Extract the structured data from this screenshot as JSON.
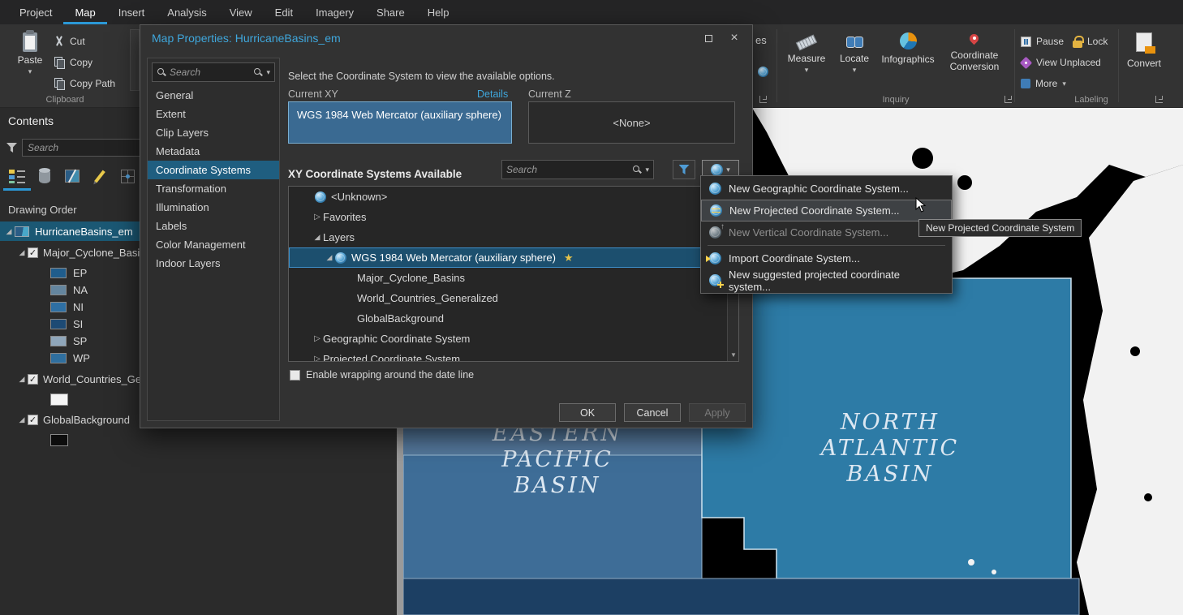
{
  "menubar": {
    "items": [
      "Project",
      "Map",
      "Insert",
      "Analysis",
      "View",
      "Edit",
      "Imagery",
      "Share",
      "Help"
    ]
  },
  "ribbon": {
    "clipboard": {
      "paste": "Paste",
      "cut": "Cut",
      "copy": "Copy",
      "copy_path": "Copy Path",
      "group": "Clipboard"
    },
    "clipped_text": "es",
    "inquiry": {
      "measure": "Measure",
      "locate": "Locate",
      "infographics": "Infographics",
      "coord_line1": "Coordinate",
      "coord_line2": "Conversion",
      "group": "Inquiry"
    },
    "labeling": {
      "pause": "Pause",
      "lock": "Lock",
      "view_unplaced": "View Unplaced",
      "more": "More",
      "convert": "Convert",
      "group": "Labeling"
    }
  },
  "contents": {
    "title": "Contents",
    "search_placeholder": "Search",
    "drawing_order": "Drawing Order",
    "map_item": "HurricaneBasins_em",
    "group_layer": "Major_Cyclone_Basins",
    "legend": [
      {
        "label": "EP",
        "color": "#205d8c"
      },
      {
        "label": "NA",
        "color": "#64859e"
      },
      {
        "label": "NI",
        "color": "#2e6fa3"
      },
      {
        "label": "SI",
        "color": "#1d4a74"
      },
      {
        "label": "SP",
        "color": "#8fa6ba"
      },
      {
        "label": "WP",
        "color": "#2f6f9f"
      }
    ],
    "countries_layer": "World_Countries_Generalized",
    "countries_swatch": "#f5f5f5",
    "background_layer": "GlobalBackground",
    "background_swatch": "#0d0d0d"
  },
  "dialog": {
    "title": "Map Properties: HurricaneBasins_em",
    "sidebar_search_placeholder": "Search",
    "nav": [
      "General",
      "Extent",
      "Clip Layers",
      "Metadata",
      "Coordinate Systems",
      "Transformation",
      "Illumination",
      "Labels",
      "Color Management",
      "Indoor Layers"
    ],
    "instruction": "Select the Coordinate System to view the available options.",
    "current_xy_label": "Current XY",
    "details_link": "Details",
    "current_z_label": "Current Z",
    "current_xy_value": "WGS 1984 Web Mercator (auxiliary sphere)",
    "current_z_value": "<None>",
    "available_heading": "XY Coordinate Systems Available",
    "tree_search_placeholder": "Search",
    "tree": [
      "<Unknown>",
      "Favorites",
      "Layers",
      "WGS 1984 Web Mercator (auxiliary sphere)",
      "Major_Cyclone_Basins",
      "World_Countries_Generalized",
      "GlobalBackground",
      "Geographic Coordinate System",
      "Projected Coordinate System"
    ],
    "wrap_label": "Enable wrapping around the date line",
    "ok": "OK",
    "cancel": "Cancel",
    "apply": "Apply"
  },
  "context_menu": {
    "items": [
      "New Geographic Coordinate System...",
      "New Projected Coordinate System...",
      "New Vertical Coordinate System...",
      "Import Coordinate System...",
      "New suggested projected coordinate system..."
    ]
  },
  "tooltip": "New Projected Coordinate System",
  "map": {
    "colors": {
      "ep_basin": "#3e6d97",
      "ep_basin_top": "#54789c",
      "na_basin": "#2d7ba6",
      "deep_basin": "#1c3f63"
    },
    "basins": [
      {
        "name": "EASTERN PACIFIC BASIN",
        "lines": [
          "EASTERN",
          "PACIFIC",
          "BASIN"
        ]
      },
      {
        "name": "NORTH ATLANTIC BASIN",
        "lines": [
          "NORTH",
          "ATLANTIC",
          "BASIN"
        ]
      }
    ]
  }
}
